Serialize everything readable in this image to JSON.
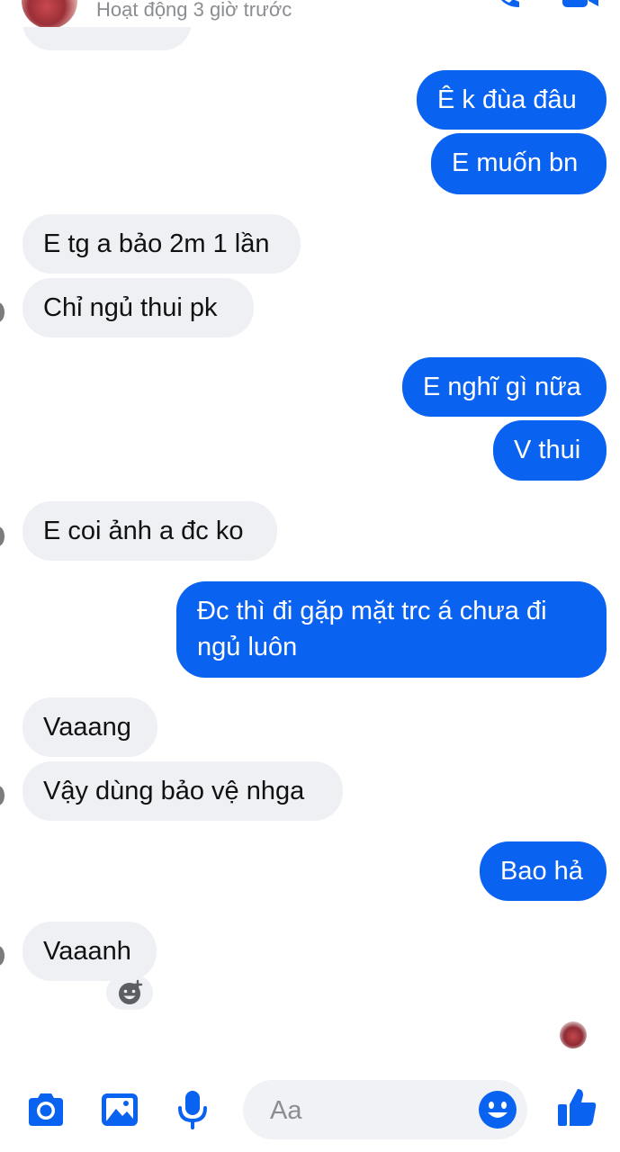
{
  "header": {
    "status": "Hoạt động 3 giờ trước"
  },
  "messages": [
    {
      "side": "in",
      "text": ""
    },
    {
      "side": "out",
      "text": "Ê k đùa đâu"
    },
    {
      "side": "out",
      "text": "E muốn bn"
    },
    {
      "side": "in",
      "text": "E tg a bảo 2m 1 lần"
    },
    {
      "side": "in",
      "text": "Chỉ ngủ thui pk"
    },
    {
      "side": "out",
      "text": "E nghĩ gì nữa"
    },
    {
      "side": "out",
      "text": "V thui"
    },
    {
      "side": "in",
      "text": "E coi ảnh a đc ko"
    },
    {
      "side": "out",
      "text": "Đc thì đi gặp mặt trc á chưa đi ngủ luôn"
    },
    {
      "side": "in",
      "text": "Vaaang"
    },
    {
      "side": "in",
      "text": "Vậy dùng bảo vệ nhga"
    },
    {
      "side": "out",
      "text": "Bao hả"
    },
    {
      "side": "in",
      "text": "Vaaanh"
    }
  ],
  "composer": {
    "placeholder": "Aa"
  },
  "colors": {
    "outgoing": "#0a62f0",
    "incoming": "#eef0f4",
    "accent": "#0a62f0"
  },
  "icons": [
    "phone-icon",
    "video-camera-icon",
    "camera-icon",
    "image-icon",
    "microphone-icon",
    "emoji-icon",
    "thumbs-up-icon",
    "add-reaction-icon"
  ]
}
